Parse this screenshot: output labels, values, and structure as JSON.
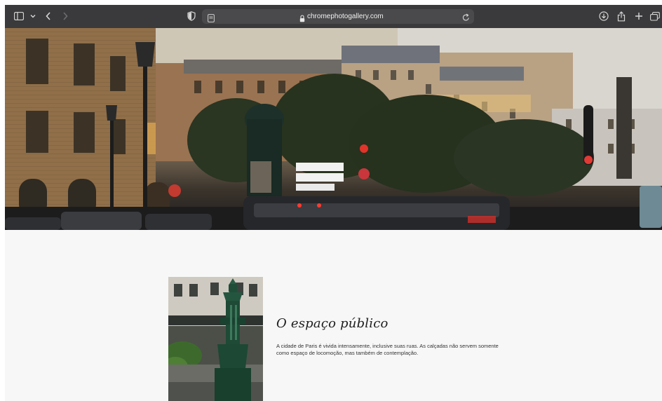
{
  "browser": {
    "url": "chromephotogallery.com",
    "icons": {
      "sidebar": "sidebar-icon",
      "sidebar_menu": "chevron-down-icon",
      "back": "chevron-left-icon",
      "forward": "chevron-right-icon",
      "privacy": "shield-icon",
      "page": "page-icon",
      "lock": "lock-icon",
      "reload": "reload-icon",
      "download": "download-icon",
      "share": "share-icon",
      "new_tab": "plus-icon",
      "tabs": "tab-overview-icon"
    }
  },
  "hero": {
    "image": "paris-street-photo"
  },
  "section": {
    "title": "O espaço público",
    "text": "A cidade de Paris é vivida intensamente, inclusive suas ruas. As calçadas não servem somente como espaço de locomoção, mas também de contemplação.",
    "thumbnail": "wallace-fountain-photo"
  },
  "colors": {
    "toolbar": "#3a3a3c",
    "addressbar": "#4a4a4c",
    "page_background": "#f7f7f7",
    "title": "#1f1f1f",
    "text": "#333333"
  }
}
